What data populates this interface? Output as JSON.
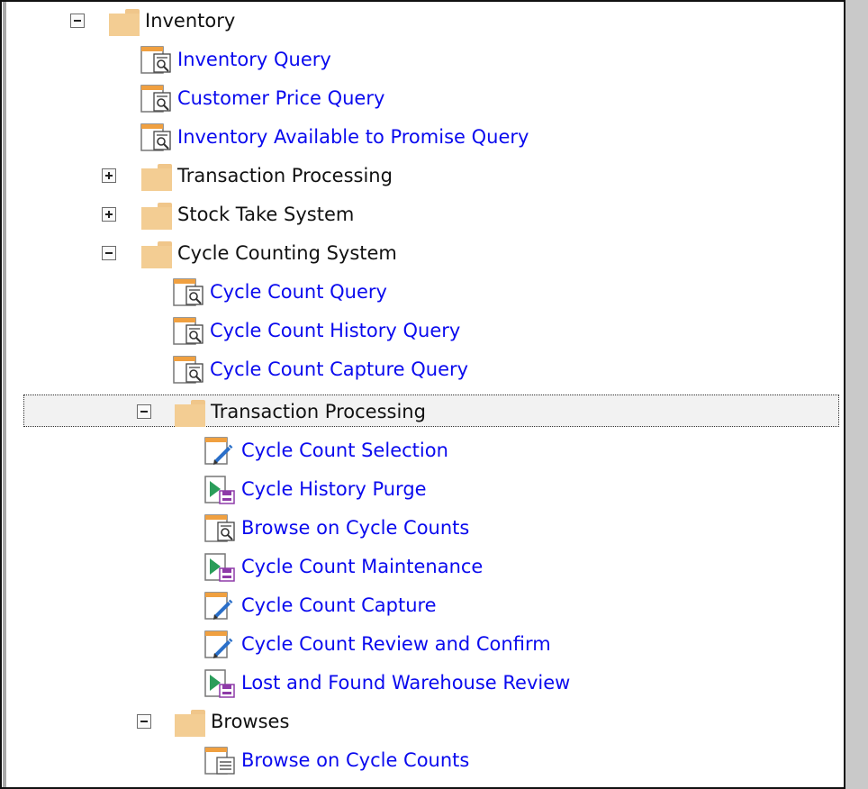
{
  "colors": {
    "link": "#0a0aee",
    "folder": "#f3cd93",
    "folder_text": "#111111",
    "right_panel": "#c9c9c9"
  },
  "tree": [
    {
      "type": "folder",
      "label": "Inventory",
      "expanded": true,
      "icon": "folder-icon"
    },
    {
      "type": "item",
      "label": "Inventory Query",
      "icon": "query-icon"
    },
    {
      "type": "item",
      "label": "Customer Price Query",
      "icon": "query-icon"
    },
    {
      "type": "item",
      "label": "Inventory Available to Promise Query",
      "icon": "query-icon"
    },
    {
      "type": "folder",
      "label": "Transaction Processing",
      "expanded": false,
      "icon": "folder-icon"
    },
    {
      "type": "folder",
      "label": "Stock Take System",
      "expanded": false,
      "icon": "folder-icon"
    },
    {
      "type": "folder",
      "label": "Cycle Counting System",
      "expanded": true,
      "icon": "folder-icon"
    },
    {
      "type": "item",
      "label": "Cycle Count Query",
      "icon": "query-icon"
    },
    {
      "type": "item",
      "label": "Cycle Count History Query",
      "icon": "query-icon"
    },
    {
      "type": "item",
      "label": "Cycle Count Capture Query",
      "icon": "query-icon"
    },
    {
      "type": "folder",
      "label": "Transaction Processing",
      "expanded": true,
      "selected": true,
      "icon": "folder-icon"
    },
    {
      "type": "item",
      "label": "Cycle Count Selection",
      "icon": "edit-form-icon"
    },
    {
      "type": "item",
      "label": "Cycle History Purge",
      "icon": "run-program-icon"
    },
    {
      "type": "item",
      "label": "Browse on Cycle Counts",
      "icon": "query-icon"
    },
    {
      "type": "item",
      "label": "Cycle Count Maintenance",
      "icon": "run-program-icon"
    },
    {
      "type": "item",
      "label": "Cycle Count Capture",
      "icon": "edit-form-icon"
    },
    {
      "type": "item",
      "label": "Cycle Count Review and Confirm",
      "icon": "edit-form-icon"
    },
    {
      "type": "item",
      "label": "Lost and Found Warehouse Review",
      "icon": "run-program-icon"
    },
    {
      "type": "folder",
      "label": "Browses",
      "expanded": true,
      "icon": "folder-icon"
    },
    {
      "type": "item",
      "label": "Browse on Cycle Counts",
      "icon": "browse-list-icon"
    }
  ]
}
